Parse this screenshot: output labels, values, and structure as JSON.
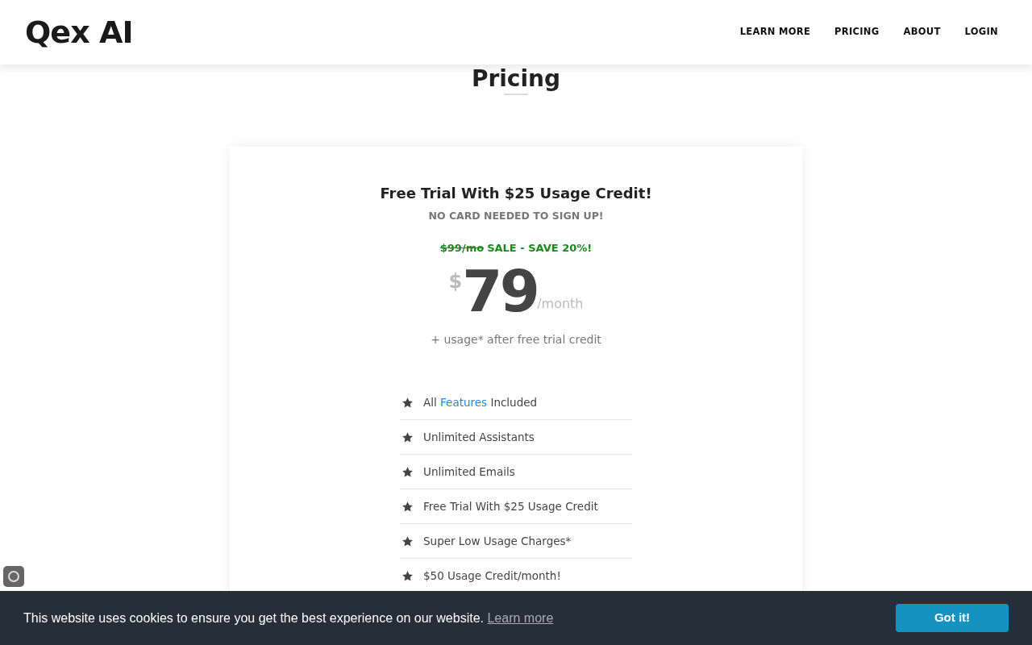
{
  "header": {
    "logo": "Qex AI",
    "nav": [
      {
        "label": "LEARN MORE"
      },
      {
        "label": "PRICING"
      },
      {
        "label": "ABOUT"
      },
      {
        "label": "LOGIN"
      }
    ]
  },
  "section_title": "Pricing",
  "plan": {
    "title": "Free Trial With $25 Usage Credit!",
    "subtitle": "NO CARD NEEDED TO SIGN UP!",
    "old_price": "$99/mo",
    "sale": "SALE - SAVE 20%!",
    "currency": "$",
    "amount": "79",
    "period": "/month",
    "note": "+ usage* after free trial credit",
    "features": [
      {
        "text": "All",
        "link": "Features",
        "after": "Included"
      },
      {
        "text": "Unlimited Assistants"
      },
      {
        "text": "Unlimited Emails"
      },
      {
        "text": "Free Trial With $25 Usage Credit"
      },
      {
        "text": "Super Low Usage Charges*"
      },
      {
        "text": "$50 Usage Credit/month!"
      }
    ]
  },
  "cookie_bar": {
    "message": "This website uses cookies to ensure you get the best experience on our website.",
    "link": "Learn more",
    "button": "Got it!"
  }
}
